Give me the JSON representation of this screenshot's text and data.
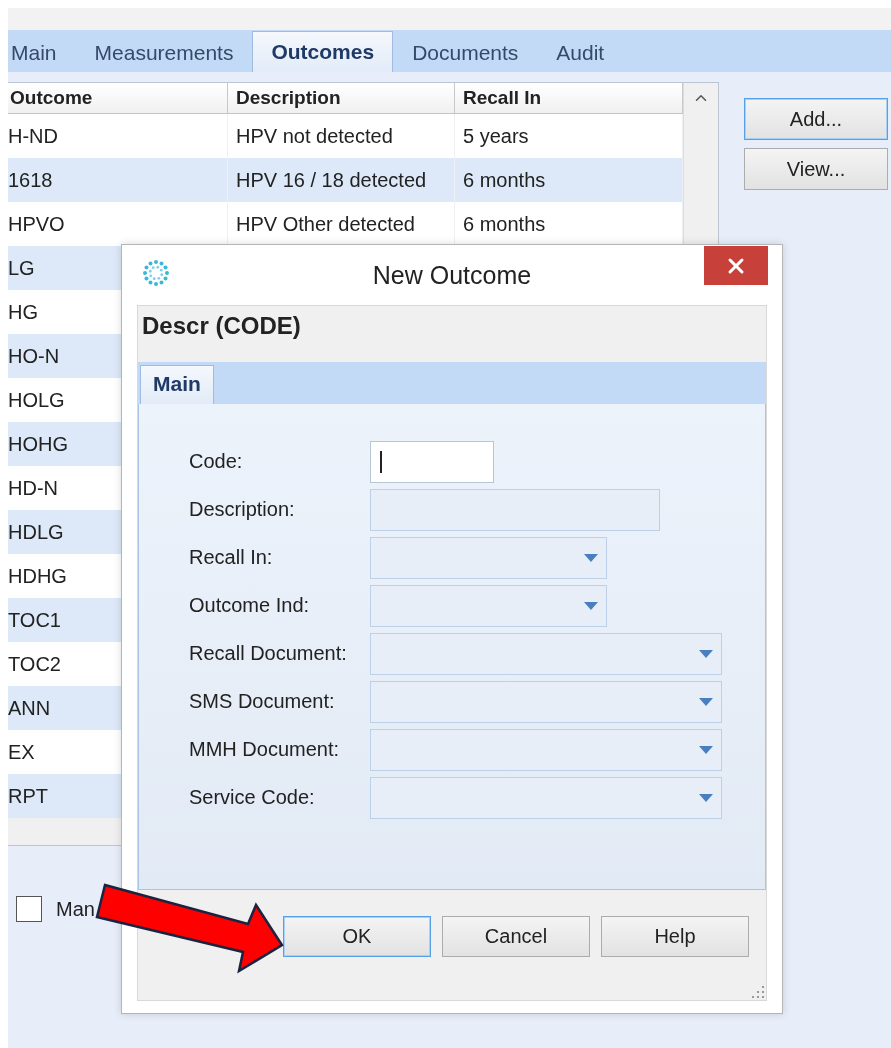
{
  "tabs": [
    {
      "label": "Main",
      "selected": false
    },
    {
      "label": "Measurements",
      "selected": false
    },
    {
      "label": "Outcomes",
      "selected": true
    },
    {
      "label": "Documents",
      "selected": false
    },
    {
      "label": "Audit",
      "selected": false
    }
  ],
  "table": {
    "columns": [
      "Outcome",
      "Description",
      "Recall In"
    ],
    "rows": [
      {
        "outcome": "H-ND",
        "description": "HPV not detected",
        "recall_in": "5 years"
      },
      {
        "outcome": "1618",
        "description": "HPV 16 / 18 detected",
        "recall_in": "6 months"
      },
      {
        "outcome": "HPVO",
        "description": "HPV Other detected",
        "recall_in": "6 months"
      },
      {
        "outcome": "LG"
      },
      {
        "outcome": "HG"
      },
      {
        "outcome": "HO-N"
      },
      {
        "outcome": "HOLG"
      },
      {
        "outcome": "HOHG"
      },
      {
        "outcome": "HD-N"
      },
      {
        "outcome": "HDLG"
      },
      {
        "outcome": "HDHG"
      },
      {
        "outcome": "TOC1"
      },
      {
        "outcome": "TOC2"
      },
      {
        "outcome": "ANN"
      },
      {
        "outcome": "EX"
      },
      {
        "outcome": "RPT"
      }
    ]
  },
  "side_buttons": [
    {
      "label": "Add...",
      "focused": true
    },
    {
      "label": "View...",
      "focused": false
    }
  ],
  "checkbox": {
    "label": "Man",
    "checked": false
  },
  "dialog": {
    "title": "New Outcome",
    "header": "Descr (CODE)",
    "tabs": [
      {
        "label": "Main",
        "selected": true
      }
    ],
    "fields": [
      {
        "label": "Code:",
        "kind": "text",
        "focused": true,
        "disabled": false
      },
      {
        "label": "Description:",
        "kind": "text",
        "focused": false,
        "disabled": true
      },
      {
        "label": "Recall In:",
        "kind": "dropdown",
        "focused": false,
        "disabled": true
      },
      {
        "label": "Outcome Ind:",
        "kind": "dropdown",
        "focused": false,
        "disabled": true
      },
      {
        "label": "Recall Document:",
        "kind": "dropdown",
        "focused": false,
        "disabled": true
      },
      {
        "label": "SMS Document:",
        "kind": "dropdown",
        "focused": false,
        "disabled": true
      },
      {
        "label": "MMH Document:",
        "kind": "dropdown",
        "focused": false,
        "disabled": true
      },
      {
        "label": "Service Code:",
        "kind": "dropdown",
        "focused": false,
        "disabled": true
      }
    ],
    "buttons": [
      {
        "label": "OK",
        "focused": true
      },
      {
        "label": "Cancel",
        "focused": false
      },
      {
        "label": "Help",
        "focused": false
      }
    ]
  }
}
